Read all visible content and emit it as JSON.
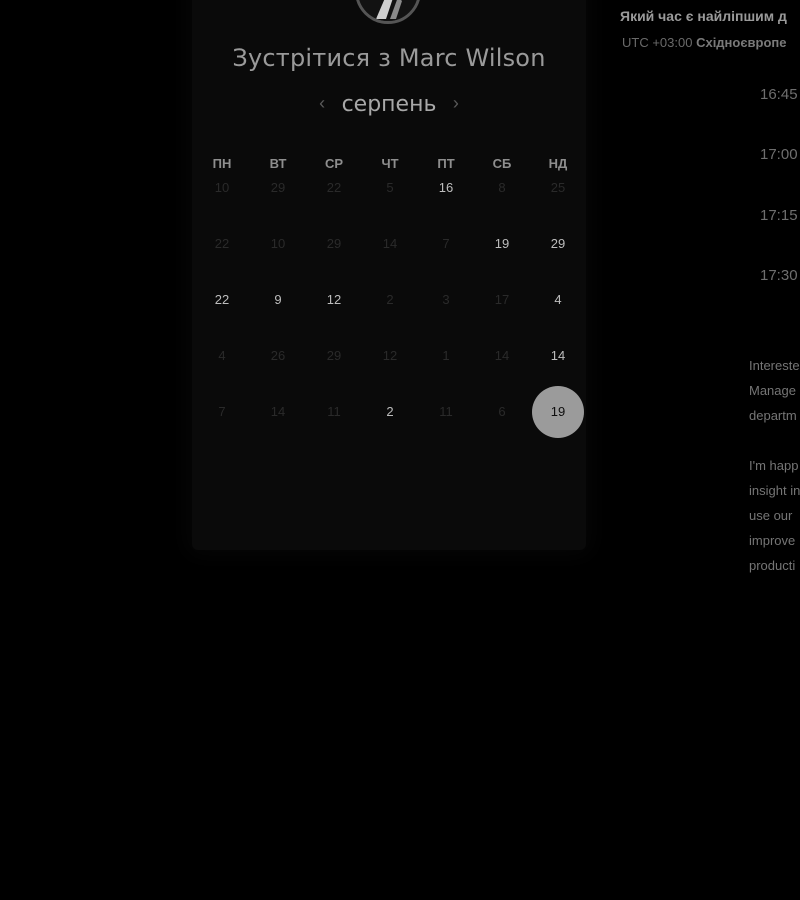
{
  "header": {
    "title": "Зустрітися з Marc Wilson"
  },
  "avatar": {
    "icon": "avatar-photo"
  },
  "calendar": {
    "month": "серпень",
    "prev_icon": "chevron-left-icon",
    "next_icon": "chevron-right-icon",
    "prev_glyph": "‹",
    "next_glyph": "›",
    "weekdays": [
      "ПН",
      "ВТ",
      "СР",
      "ЧТ",
      "ПТ",
      "СБ",
      "НД"
    ],
    "weeks": [
      [
        {
          "label": "10",
          "state": "disabled"
        },
        {
          "label": "29",
          "state": "disabled"
        },
        {
          "label": "22",
          "state": "disabled"
        },
        {
          "label": "5",
          "state": "disabled"
        },
        {
          "label": "16",
          "state": "available"
        },
        {
          "label": "8",
          "state": "disabled"
        },
        {
          "label": "25",
          "state": "disabled"
        }
      ],
      [
        {
          "label": "22",
          "state": "disabled"
        },
        {
          "label": "10",
          "state": "disabled"
        },
        {
          "label": "29",
          "state": "disabled"
        },
        {
          "label": "14",
          "state": "disabled"
        },
        {
          "label": "7",
          "state": "disabled"
        },
        {
          "label": "19",
          "state": "available"
        },
        {
          "label": "29",
          "state": "available"
        }
      ],
      [
        {
          "label": "22",
          "state": "available"
        },
        {
          "label": "9",
          "state": "available"
        },
        {
          "label": "12",
          "state": "available"
        },
        {
          "label": "2",
          "state": "disabled"
        },
        {
          "label": "3",
          "state": "disabled"
        },
        {
          "label": "17",
          "state": "disabled"
        },
        {
          "label": "4",
          "state": "available"
        }
      ],
      [
        {
          "label": "4",
          "state": "disabled"
        },
        {
          "label": "26",
          "state": "disabled"
        },
        {
          "label": "29",
          "state": "disabled"
        },
        {
          "label": "12",
          "state": "disabled"
        },
        {
          "label": "1",
          "state": "disabled"
        },
        {
          "label": "14",
          "state": "disabled"
        },
        {
          "label": "14",
          "state": "available"
        }
      ],
      [
        {
          "label": "7",
          "state": "disabled"
        },
        {
          "label": "14",
          "state": "disabled"
        },
        {
          "label": "11",
          "state": "disabled"
        },
        {
          "label": "2",
          "state": "available"
        },
        {
          "label": "11",
          "state": "disabled"
        },
        {
          "label": "6",
          "state": "disabled"
        },
        {
          "label": "19",
          "state": "selected"
        }
      ]
    ]
  },
  "right_panel": {
    "question": "Який час є найліпшим д",
    "timezone_prefix": "UTC +03:00",
    "timezone_name": "Східноєвропе",
    "slots": [
      "16:45",
      "17:00",
      "17:15",
      "17:30"
    ],
    "note_lines_1": [
      "Intereste",
      "Manage",
      "departm"
    ],
    "note_lines_2": [
      "I'm happ",
      "insight in",
      "use our",
      "improve",
      "producti"
    ]
  },
  "colors": {
    "background": "#000000",
    "card": "#0a0a0a",
    "selected_day": "#9b9b9b",
    "available_text": "#bdbdbd",
    "disabled_text": "#2a2a2a"
  }
}
